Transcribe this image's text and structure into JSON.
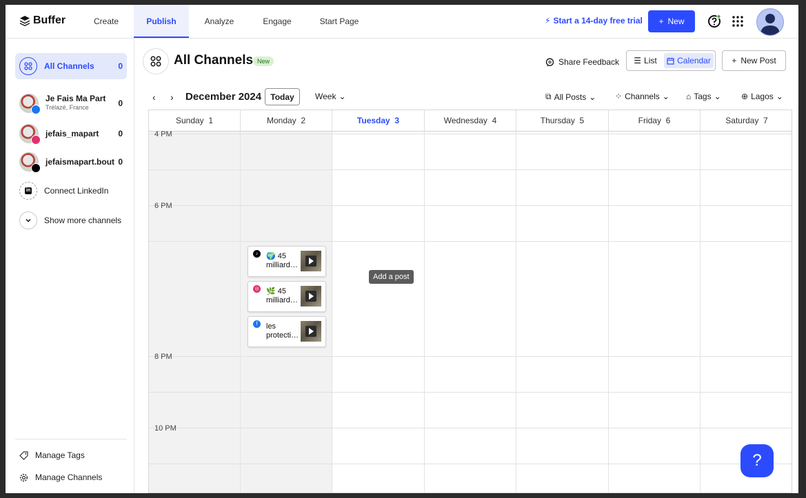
{
  "topnav": {
    "logo": "Buffer",
    "tabs": [
      "Create",
      "Publish",
      "Analyze",
      "Engage",
      "Start Page"
    ],
    "trial": "Start a 14-day free trial",
    "new_button": "New"
  },
  "sidebar": {
    "all_channels": {
      "label": "All Channels",
      "count": "0"
    },
    "channels": [
      {
        "name": "Je Fais Ma Part",
        "location": "Trélazé, France",
        "count": "0",
        "network": "facebook"
      },
      {
        "name": "jefais_mapart",
        "count": "0",
        "network": "instagram"
      },
      {
        "name": "jefaismapart.bout",
        "count": "0",
        "network": "tiktok"
      }
    ],
    "connect_linkedin": "Connect LinkedIn",
    "show_more": "Show more channels",
    "manage_tags": "Manage Tags",
    "manage_channels": "Manage Channels"
  },
  "header": {
    "title": "All Channels",
    "badge": "New",
    "share_feedback": "Share Feedback",
    "view_list": "List",
    "view_calendar": "Calendar",
    "new_post": "New Post"
  },
  "toolbar": {
    "month": "December 2024",
    "today": "Today",
    "range": "Week",
    "filters": [
      "All Posts",
      "Channels",
      "Tags",
      "Lagos"
    ]
  },
  "calendar": {
    "days": [
      {
        "name": "Sunday",
        "num": "1"
      },
      {
        "name": "Monday",
        "num": "2"
      },
      {
        "name": "Tuesday",
        "num": "3"
      },
      {
        "name": "Wednesday",
        "num": "4"
      },
      {
        "name": "Thursday",
        "num": "5"
      },
      {
        "name": "Friday",
        "num": "6"
      },
      {
        "name": "Saturday",
        "num": "7"
      }
    ],
    "today_index": 2,
    "times": [
      "4 PM",
      "6 PM",
      "8 PM",
      "10 PM"
    ],
    "tooltip": "Add a post",
    "posts": [
      {
        "network": "tiktok",
        "emoji": "🌍",
        "text": "45 milliard…"
      },
      {
        "network": "instagram",
        "emoji": "🌿",
        "text": "45 milliard…"
      },
      {
        "network": "facebook",
        "emoji": "",
        "text": "les protecti…"
      }
    ]
  },
  "help_fab": "?",
  "colors": {
    "accent": "#2c4bff",
    "facebook": "#1877f2",
    "instagram": "#e1306c",
    "tiktok": "#000000"
  }
}
